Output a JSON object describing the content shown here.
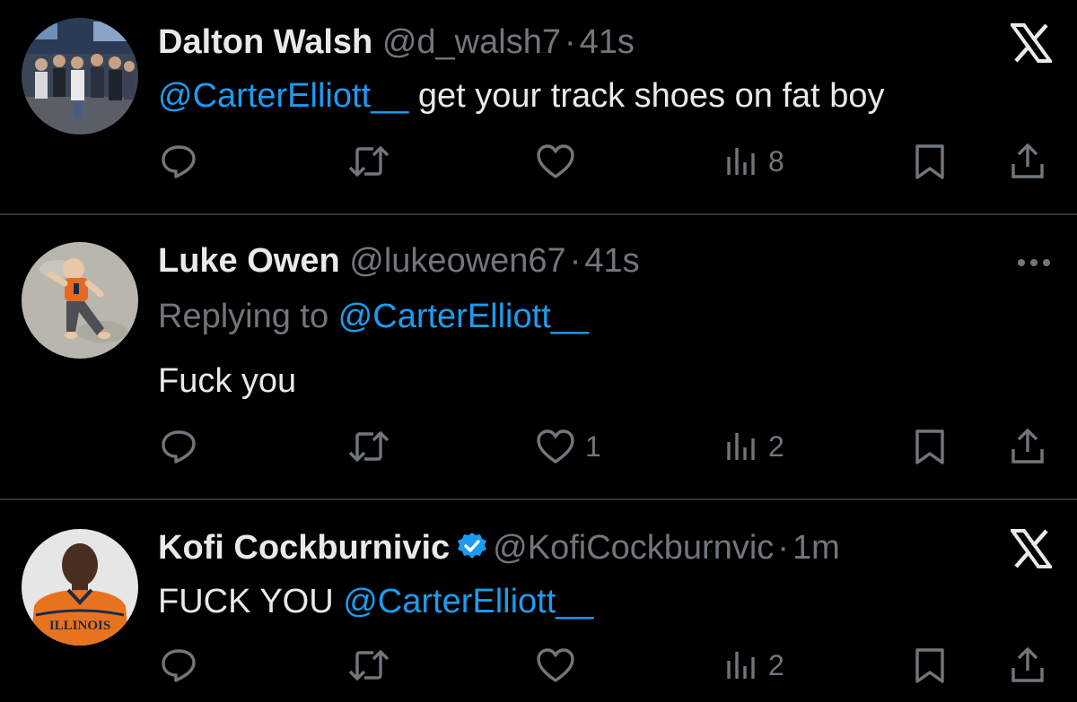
{
  "tweets": [
    {
      "name": "Dalton Walsh",
      "handle": "@d_walsh7",
      "separator": "·",
      "time": "41s",
      "reply_prefix": "",
      "reply_to": "",
      "mention": "@CarterElliott__",
      "text": " get your track shoes on fat boy",
      "verified": false,
      "corner_icon": "x-logo-icon",
      "counts": {
        "reply": "",
        "retweet": "",
        "like": "",
        "views": "8"
      }
    },
    {
      "name": "Luke Owen",
      "handle": "@lukeowen67",
      "separator": "·",
      "time": "41s",
      "reply_prefix": "Replying to ",
      "reply_to": "@CarterElliott__",
      "mention": "",
      "text": "Fuck you",
      "verified": false,
      "corner_icon": "more-icon",
      "counts": {
        "reply": "",
        "retweet": "",
        "like": "1",
        "views": "2"
      }
    },
    {
      "name": "Kofi Cockburnivic",
      "handle": "@KofiCockburnvic",
      "separator": "·",
      "time": "1m",
      "reply_prefix": "",
      "reply_to": "",
      "prefix_text": "FUCK YOU ",
      "mention": "@CarterElliott__",
      "text": "",
      "verified": true,
      "corner_icon": "x-logo-icon",
      "counts": {
        "reply": "",
        "retweet": "",
        "like": "",
        "views": "2"
      }
    }
  ],
  "colors": {
    "background": "#000000",
    "text": "#e7e9ea",
    "secondary": "#71767b",
    "link": "#1d9bf0",
    "verified": "#1d9bf0",
    "divider": "#2f3336"
  },
  "avatar_jersey_text": "ILLINOIS"
}
